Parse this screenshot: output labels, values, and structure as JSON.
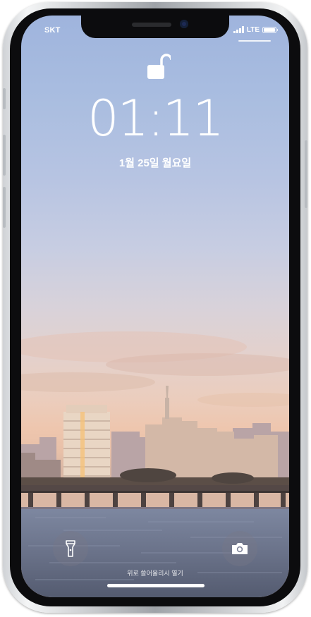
{
  "status_bar": {
    "carrier": "SKT",
    "network": "LTE"
  },
  "lock_screen": {
    "time": "01:11",
    "date": "1월 25일 월요일",
    "hint": "위로 쓸어올리시 열기"
  },
  "icons": {
    "lock": "unlocked-padlock-icon",
    "flashlight": "flashlight-icon",
    "camera": "camera-icon"
  },
  "colors": {
    "sky_top": "#9fb4dd",
    "sky_bottom": "#e8c0a8",
    "water": "#6e7790",
    "text": "#ffffff"
  }
}
